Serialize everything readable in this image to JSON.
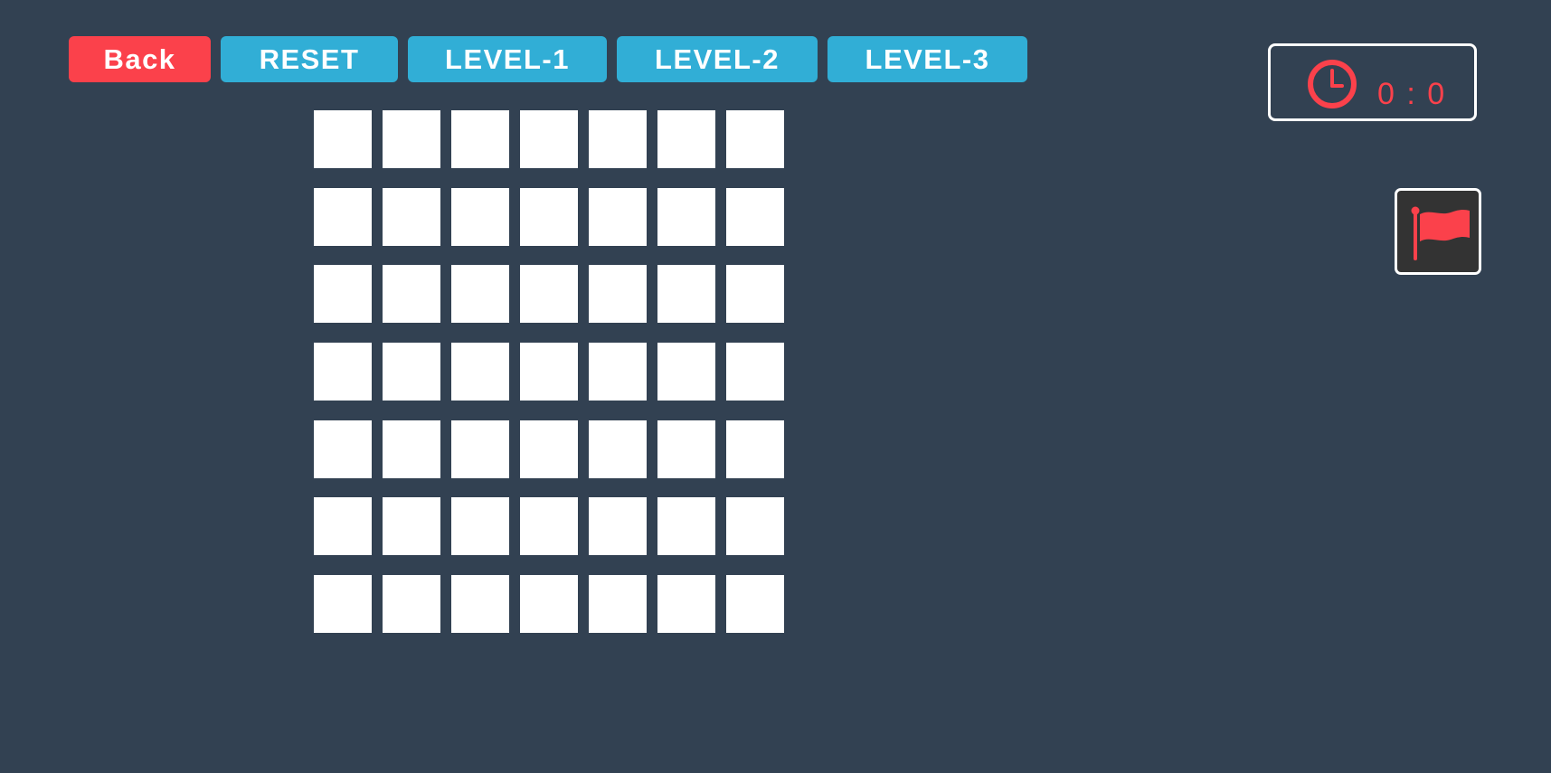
{
  "toolbar": {
    "back_label": "Back",
    "reset_label": "RESET",
    "levels": [
      "LEVEL-1",
      "LEVEL-2",
      "LEVEL-3"
    ]
  },
  "timer": {
    "icon": "clock-icon",
    "text": "0 : 0"
  },
  "flag_button": {
    "icon": "flag-icon"
  },
  "board": {
    "rows": 7,
    "columns": 7,
    "cells_state": "all-unrevealed"
  },
  "colors": {
    "background": "#324152",
    "back_button": "#fb414b",
    "level_button": "#31aed6",
    "timer_text": "#fb414b",
    "flag": "#fb414b",
    "cell": "#ffffff"
  }
}
